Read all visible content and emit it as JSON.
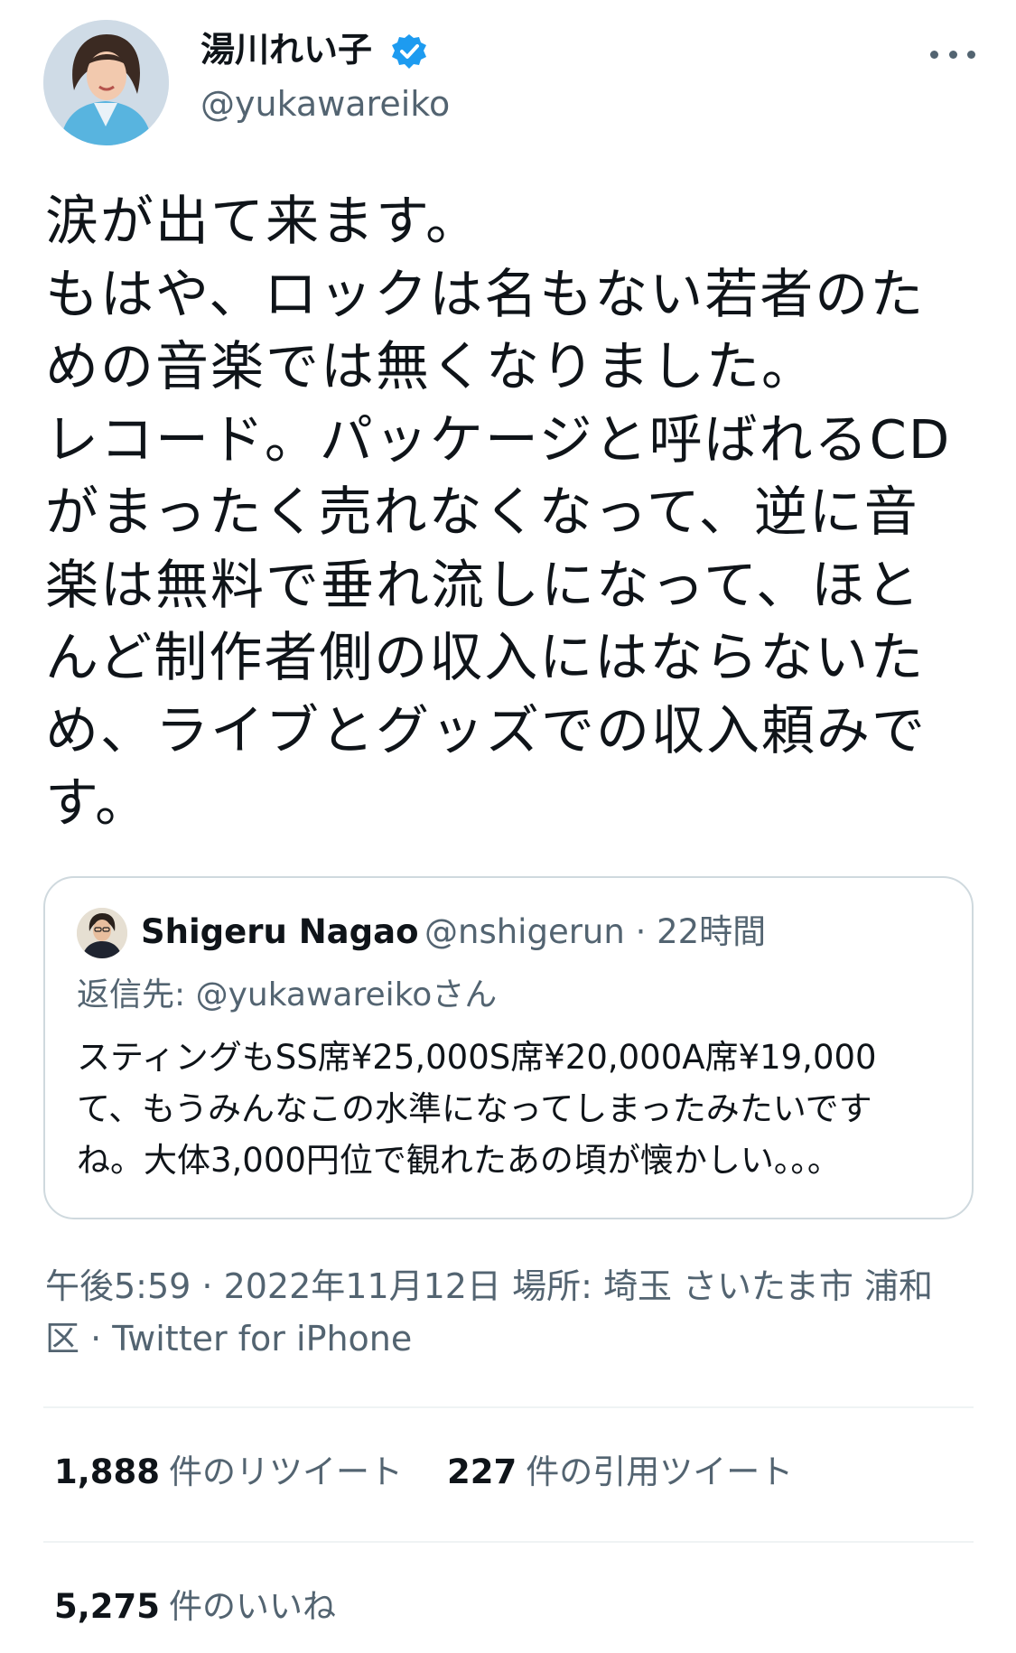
{
  "author": {
    "display_name": "湯川れい子",
    "handle": "@yukawareiko",
    "verified": true,
    "avatar_icon": "profile-photo-avatar",
    "verified_color": "#1d9bf0"
  },
  "tweet": {
    "text_lines": [
      "涙が出て来ます。",
      "もはや、ロックは名もない若者のた",
      "めの音楽では無くなりました。",
      "レコード。パッケージと呼ばれるCD",
      "がまったく売れなくなって、逆に音",
      "楽は無料で垂れ流しになって、ほと",
      "んど制作者側の収入にはならないた",
      "め、ライブとグッズでの収入頼みで",
      "す。"
    ]
  },
  "quote": {
    "display_name": "Shigeru Nagao",
    "handle_time": "@nshigerun · 22時間",
    "replying_to": "返信先: @yukawareikoさん",
    "text_lines": [
      "スティングもSS席¥25,000S席¥20,000A席¥19,000",
      "て、もうみんなこの水準になってしまったみたいです",
      "ね。大体3,000円位で観れたあの頃が懐かしい。。。"
    ]
  },
  "meta": {
    "line1": "午後5:59 · 2022年11月12日 場所: 埼玉 さいたま市 浦和",
    "line2": "区 · Twitter for iPhone"
  },
  "stats": {
    "retweets": {
      "count": "1,888",
      "label": "件のリツイート"
    },
    "quotes": {
      "count": "227",
      "label": "件の引用ツイート"
    },
    "likes": {
      "count": "5,275",
      "label": "件のいいね"
    }
  }
}
